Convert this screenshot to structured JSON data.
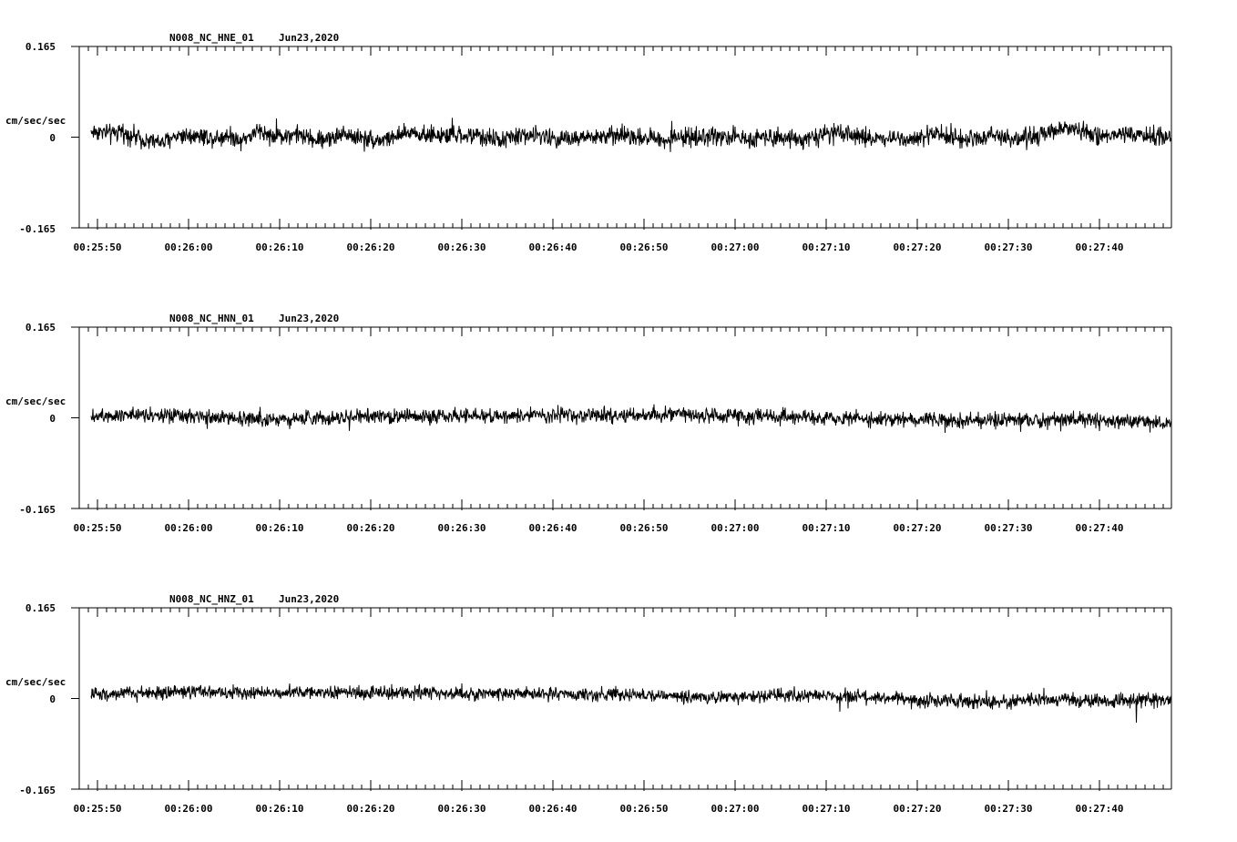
{
  "chart_data": [
    {
      "type": "line",
      "title": "N008_NC_HNE_01",
      "date": "Jun23,2020",
      "ylabel": "cm/sec/sec",
      "ylim": [
        -0.165,
        0.165
      ],
      "y_ticks": [
        "0.165",
        "0",
        "-0.165"
      ],
      "x_tick_labels": [
        "00:25:50",
        "00:26:00",
        "00:26:10",
        "00:26:20",
        "00:26:30",
        "00:26:40",
        "00:26:50",
        "00:27:00",
        "00:27:10",
        "00:27:20",
        "00:27:30",
        "00:27:40"
      ],
      "x_range_seconds": [
        0,
        118
      ],
      "noise_amplitude": 0.022,
      "trend": [
        [
          0,
          0.01
        ],
        [
          8,
          0.01
        ],
        [
          16,
          0.005
        ],
        [
          22,
          0.01
        ],
        [
          30,
          0.003
        ],
        [
          44,
          -0.008
        ],
        [
          54,
          -0.01
        ],
        [
          60,
          0.002
        ],
        [
          70,
          0.004
        ],
        [
          80,
          0.003
        ],
        [
          90,
          -0.002
        ],
        [
          100,
          0.004
        ],
        [
          110,
          -0.005
        ],
        [
          124,
          0.012
        ],
        [
          134,
          0.002
        ],
        [
          150,
          0.005
        ],
        [
          166,
          -0.006
        ],
        [
          176,
          0.0
        ],
        [
          186,
          0.006
        ],
        [
          196,
          0.0
        ],
        [
          210,
          -0.006
        ],
        [
          226,
          0.002
        ],
        [
          236,
          0.01
        ],
        [
          246,
          0.004
        ],
        [
          260,
          0.002
        ],
        [
          280,
          0.003
        ],
        [
          300,
          -0.005
        ],
        [
          316,
          0.004
        ],
        [
          330,
          0.002
        ],
        [
          350,
          -0.004
        ],
        [
          370,
          0.0
        ],
        [
          390,
          0.004
        ],
        [
          420,
          -0.004
        ],
        [
          430,
          0.0
        ],
        [
          460,
          0.002
        ],
        [
          480,
          -0.003
        ],
        [
          500,
          0.003
        ],
        [
          520,
          -0.004
        ],
        [
          540,
          0.006
        ],
        [
          560,
          0.002
        ],
        [
          580,
          -0.004
        ],
        [
          600,
          0.0
        ],
        [
          620,
          0.004
        ],
        [
          640,
          -0.003
        ],
        [
          660,
          0.004
        ],
        [
          680,
          -0.004
        ],
        [
          700,
          0.006
        ],
        [
          712,
          0.016
        ],
        [
          730,
          0.008
        ],
        [
          740,
          0.0
        ],
        [
          760,
          0.004
        ],
        [
          788,
          0.0
        ]
      ],
      "spikes": []
    },
    {
      "type": "line",
      "title": "N008_NC_HNN_01",
      "date": "Jun23,2020",
      "ylabel": "cm/sec/sec",
      "ylim": [
        -0.165,
        0.165
      ],
      "y_ticks": [
        "0.165",
        "0",
        "-0.165"
      ],
      "x_tick_labels": [
        "00:25:50",
        "00:26:00",
        "00:26:10",
        "00:26:20",
        "00:26:30",
        "00:26:40",
        "00:26:50",
        "00:27:00",
        "00:27:10",
        "00:27:20",
        "00:27:30",
        "00:27:40"
      ],
      "x_range_seconds": [
        0,
        118
      ],
      "noise_amplitude": 0.018,
      "trend": [
        [
          0,
          0.004
        ],
        [
          20,
          0.006
        ],
        [
          36,
          0.008
        ],
        [
          60,
          0.002
        ],
        [
          100,
          0.0
        ],
        [
          140,
          -0.002
        ],
        [
          180,
          0.0
        ],
        [
          220,
          0.002
        ],
        [
          260,
          0.004
        ],
        [
          300,
          0.003
        ],
        [
          340,
          0.005
        ],
        [
          380,
          0.004
        ],
        [
          420,
          0.006
        ],
        [
          460,
          0.004
        ],
        [
          500,
          0.002
        ],
        [
          540,
          0.0
        ],
        [
          580,
          -0.002
        ],
        [
          620,
          -0.004
        ],
        [
          640,
          -0.006
        ],
        [
          680,
          -0.004
        ],
        [
          720,
          -0.002
        ],
        [
          760,
          -0.006
        ],
        [
          788,
          -0.01
        ]
      ],
      "spikes": [
        [
          85,
          -0.02
        ],
        [
          560,
          0.016
        ],
        [
          700,
          -0.022
        ],
        [
          738,
          -0.024
        ]
      ]
    },
    {
      "type": "line",
      "title": "N008_NC_HNZ_01",
      "date": "Jun23,2020",
      "ylabel": "cm/sec/sec",
      "ylim": [
        -0.165,
        0.165
      ],
      "y_ticks": [
        "0.165",
        "0",
        "-0.165"
      ],
      "x_tick_labels": [
        "00:25:50",
        "00:26:00",
        "00:26:10",
        "00:26:20",
        "00:26:30",
        "00:26:40",
        "00:26:50",
        "00:27:00",
        "00:27:10",
        "00:27:20",
        "00:27:30",
        "00:27:40"
      ],
      "x_range_seconds": [
        0,
        118
      ],
      "noise_amplitude": 0.016,
      "trend": [
        [
          0,
          0.008
        ],
        [
          40,
          0.01
        ],
        [
          80,
          0.012
        ],
        [
          120,
          0.01
        ],
        [
          160,
          0.012
        ],
        [
          200,
          0.01
        ],
        [
          240,
          0.012
        ],
        [
          280,
          0.008
        ],
        [
          320,
          0.01
        ],
        [
          360,
          0.006
        ],
        [
          400,
          0.008
        ],
        [
          430,
          0.004
        ],
        [
          460,
          0.002
        ],
        [
          500,
          0.004
        ],
        [
          540,
          0.006
        ],
        [
          580,
          0.0
        ],
        [
          620,
          -0.004
        ],
        [
          660,
          -0.006
        ],
        [
          700,
          -0.002
        ],
        [
          740,
          -0.004
        ],
        [
          788,
          -0.002
        ]
      ],
      "spikes": [
        [
          548,
          -0.024
        ],
        [
          552,
          0.02
        ],
        [
          554,
          -0.018
        ],
        [
          765,
          -0.044
        ],
        [
          820,
          -0.016
        ]
      ]
    }
  ]
}
